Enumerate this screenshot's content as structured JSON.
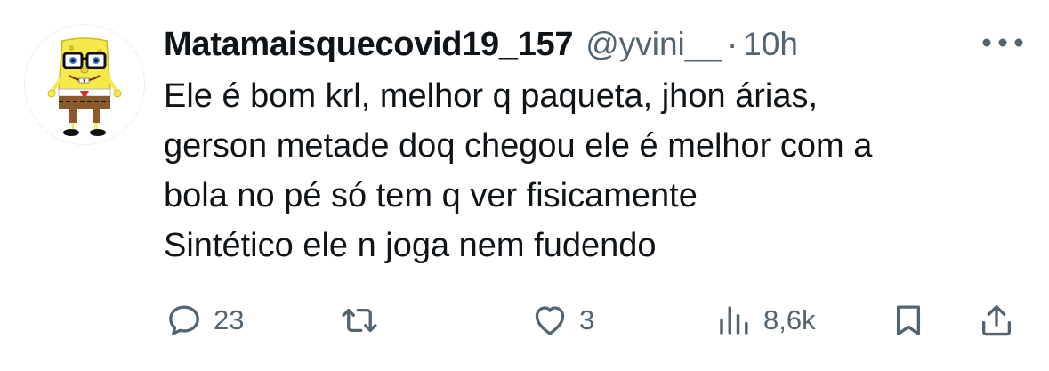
{
  "tweet": {
    "author_name": "Matamaisquecovid19_157",
    "handle": "@yvini__",
    "separator": "·",
    "time": "10h",
    "text_lines": [
      "Ele é bom krl, melhor q paqueta, jhon árias,",
      "gerson metade doq chegou ele é melhor com a",
      "bola no pé só tem q ver fisicamente",
      "Sintético ele n joga nem fudendo"
    ]
  },
  "actions": {
    "replies": "23",
    "reposts": "",
    "likes": "3",
    "views": "8,6k"
  },
  "icons": {
    "avatar": "spongebob-with-glasses-avatar",
    "more": "more-dots-icon",
    "reply": "reply-bubble-icon",
    "repost": "repost-arrows-icon",
    "like": "heart-icon",
    "views": "views-bars-icon",
    "bookmark": "bookmark-icon",
    "share": "share-upload-icon"
  },
  "colors": {
    "text_primary": "#0f1419",
    "text_secondary": "#536471",
    "background": "#ffffff"
  }
}
